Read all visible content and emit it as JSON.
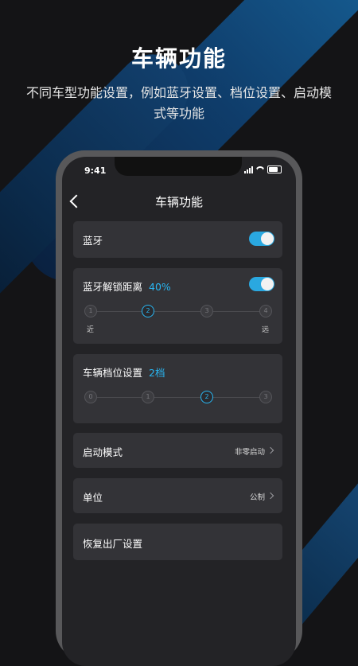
{
  "hero": {
    "title": "车辆功能",
    "subtitle": "不同车型功能设置，例如蓝牙设置、档位设置、启动模式等功能"
  },
  "status": {
    "time": "9:41"
  },
  "nav": {
    "title": "车辆功能"
  },
  "bluetooth": {
    "label": "蓝牙",
    "enabled": true
  },
  "unlock_distance": {
    "label": "蓝牙解锁距离",
    "value": "40%",
    "enabled": true,
    "steps": [
      "1",
      "2",
      "3",
      "4"
    ],
    "selected": "2",
    "near_label": "近",
    "far_label": "远"
  },
  "gear": {
    "label": "车辆档位设置",
    "value": "2档",
    "steps": [
      "0",
      "1",
      "2",
      "3"
    ],
    "selected": "2"
  },
  "start_mode": {
    "label": "启动模式",
    "value": "非零启动"
  },
  "unit": {
    "label": "单位",
    "value": "公制"
  },
  "reset": {
    "label": "恢复出厂设置"
  },
  "colors": {
    "accent": "#29b6f2",
    "card": "#333337",
    "screen": "#232326"
  }
}
